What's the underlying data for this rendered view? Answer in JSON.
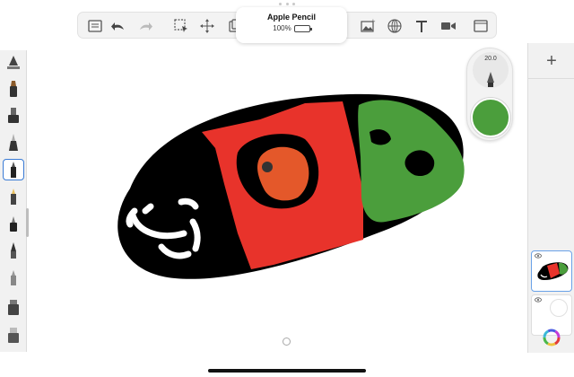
{
  "apple_pencil": {
    "name": "Apple Pencil",
    "battery": "100%",
    "battery_level": 1.0
  },
  "toolbar": {
    "left_icons": [
      "list-icon",
      "undo-icon",
      "redo-icon",
      "select-icon",
      "transform-icon",
      "copy-icon"
    ],
    "right_icons": [
      "curve-icon",
      "image-import-icon",
      "perspective-guide-icon",
      "text-icon",
      "video-icon",
      "fullscreen-icon"
    ]
  },
  "brush_palette": {
    "brushes": [
      "brush-ruler",
      "brush-marker",
      "brush-stamp",
      "brush-fountain",
      "brush-pencil",
      "brush-light-pencil",
      "brush-ink",
      "brush-pen",
      "brush-airbrush",
      "brush-roller",
      "brush-eraser"
    ],
    "selected_index": 4
  },
  "brush_puck": {
    "size": "20.0",
    "color": "#4b9e3c"
  },
  "layers": {
    "add_label": "+",
    "items": [
      {
        "visible": true,
        "selected": true
      },
      {
        "visible": true,
        "selected": false
      }
    ]
  },
  "colors": {
    "black": "#000000",
    "red": "#e8332b",
    "orange": "#e4582a",
    "green": "#4b9e3c",
    "accent_blue": "#3a7bd5"
  }
}
